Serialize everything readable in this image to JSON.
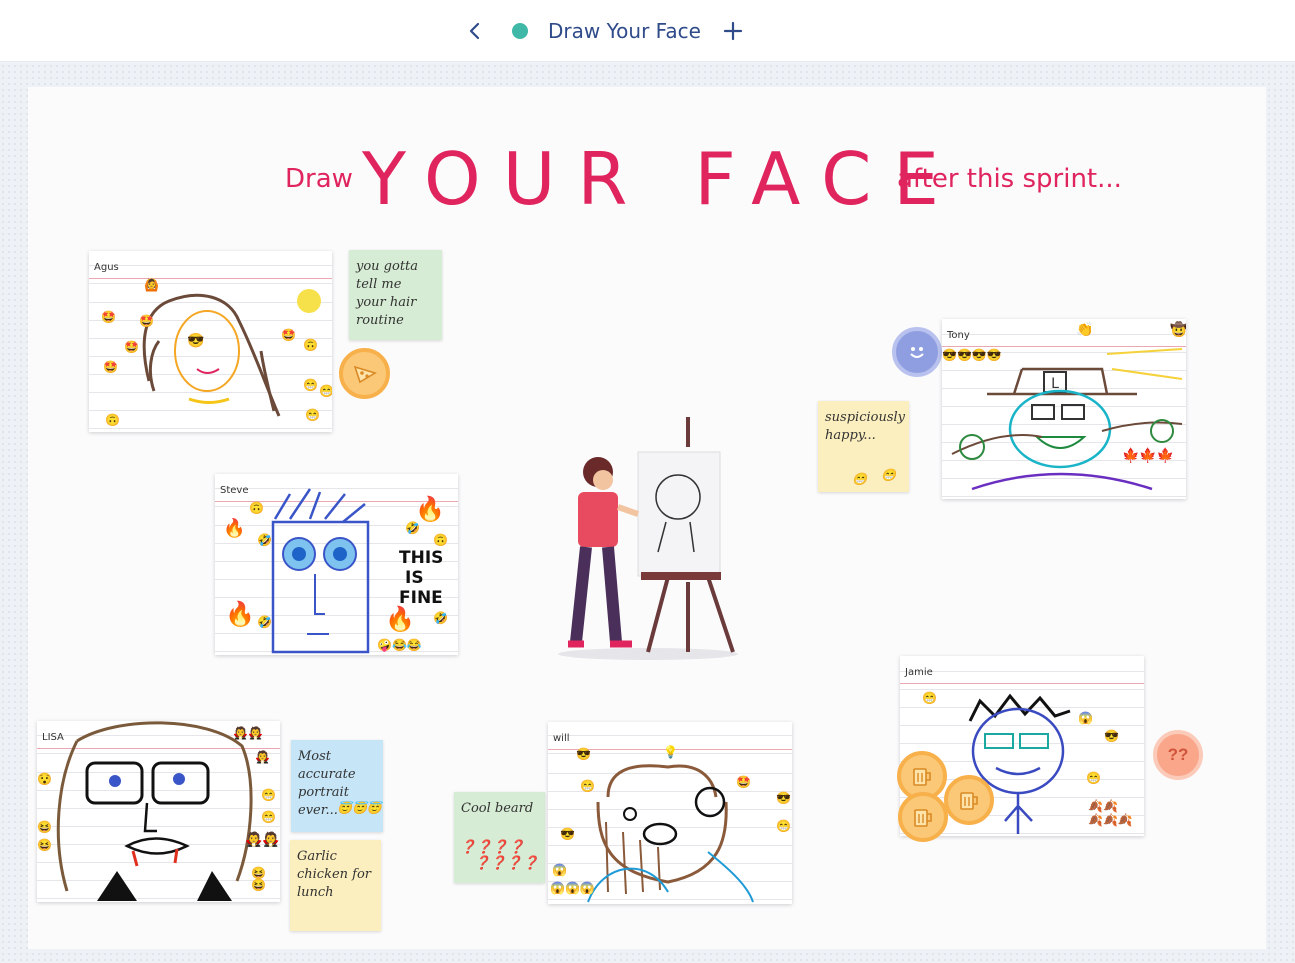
{
  "topbar": {
    "title": "Draw Your Face",
    "back_icon": "chevron-left-icon",
    "add_icon": "plus-icon",
    "status_color": "#3fb8a8"
  },
  "board": {
    "heading_prefix": "Draw",
    "heading_main": "YOUR FACE",
    "heading_suffix": "after this sprint...",
    "accent_color": "#e0245e"
  },
  "cards": {
    "agus": {
      "name": "Agus"
    },
    "steve": {
      "name": "Steve",
      "caption": [
        "THIS",
        "IS",
        "FINE"
      ]
    },
    "tony": {
      "name": "Tony",
      "hat_letter": "L"
    },
    "lisa": {
      "name": "LISA"
    },
    "will": {
      "name": "will"
    },
    "jamie": {
      "name": "Jamie"
    }
  },
  "stickies": {
    "agus_note": "you gotta tell me your hair routine",
    "tony_note": "suspiciously happy...",
    "lisa_note1": "Most accurate portrait ever...",
    "lisa_note2": "Garlic chicken for lunch",
    "will_note": "Cool beard"
  },
  "badges": {
    "jamie_question": "??",
    "pizza": "pizza-icon",
    "smiley": "smiley-icon",
    "beer": "beer-mug-icon"
  }
}
